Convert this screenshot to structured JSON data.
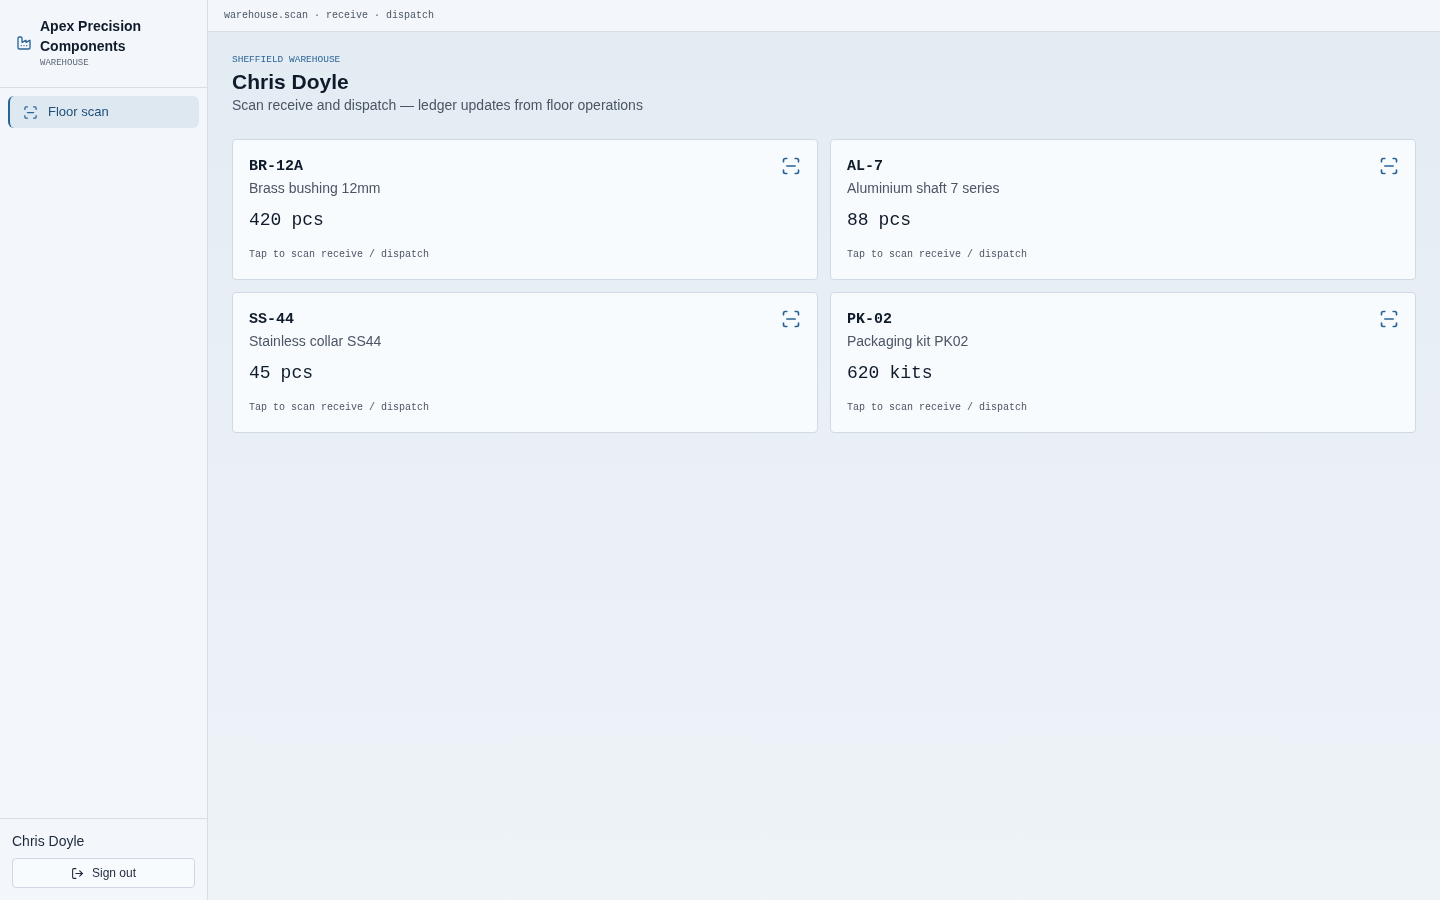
{
  "app": {
    "name": "Apex Precision Components",
    "subtitle": "WAREHOUSE"
  },
  "nav": [
    {
      "label": "Floor scan",
      "selected": true
    }
  ],
  "user": {
    "name": "Chris Doyle",
    "sign_out": "Sign out"
  },
  "breadcrumb": "warehouse.scan · receive · dispatch",
  "page": {
    "eyebrow": "SHEFFIELD WAREHOUSE",
    "title": "Chris Doyle",
    "subtitle": "Scan receive and dispatch — ledger updates from floor operations"
  },
  "items": [
    {
      "code": "BR-12A",
      "name": "Brass bushing 12mm",
      "quantity": "420",
      "unit": "pcs",
      "hint": "Tap to scan receive / dispatch"
    },
    {
      "code": "AL-7",
      "name": "Aluminium shaft 7 series",
      "quantity": "88",
      "unit": "pcs",
      "hint": "Tap to scan receive / dispatch"
    },
    {
      "code": "SS-44",
      "name": "Stainless collar SS44",
      "quantity": "45",
      "unit": "pcs",
      "hint": "Tap to scan receive / dispatch"
    },
    {
      "code": "PK-02",
      "name": "Packaging kit PK02",
      "quantity": "620",
      "unit": "kits",
      "hint": "Tap to scan receive / dispatch"
    }
  ]
}
